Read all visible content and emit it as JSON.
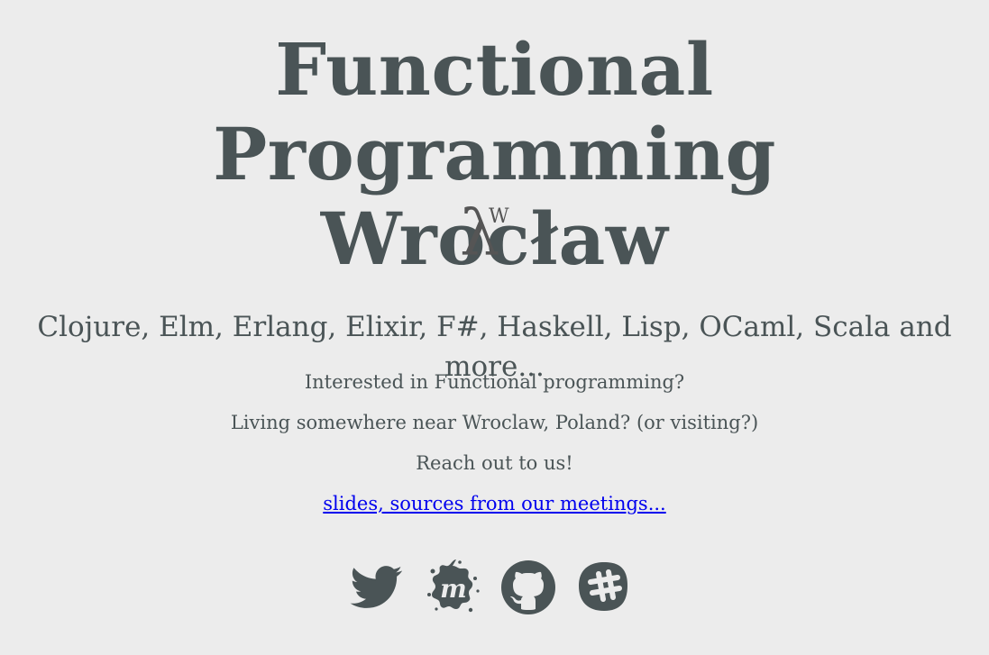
{
  "header": {
    "title_line1": "Functional Programming",
    "title_line2": "Wrocław",
    "logo": {
      "glyph": "λ",
      "superscript": "W"
    }
  },
  "main": {
    "tagline": "Clojure, Elm, Erlang, Elixir, F#, Haskell, Lisp, OCaml, Scala and more...",
    "lines": [
      "Interested in Functional programming?",
      "Living somewhere near Wroclaw, Poland? (or visiting?)",
      "Reach out to us!"
    ],
    "slides_link": "slides, sources from our meetings..."
  },
  "social": {
    "icons": [
      "twitter-icon",
      "meetup-icon",
      "github-icon",
      "slack-icon"
    ],
    "icon_color": "#4a5456"
  },
  "colors": {
    "background": "#ececec",
    "text": "#4a5456",
    "link": "#0000ee"
  }
}
